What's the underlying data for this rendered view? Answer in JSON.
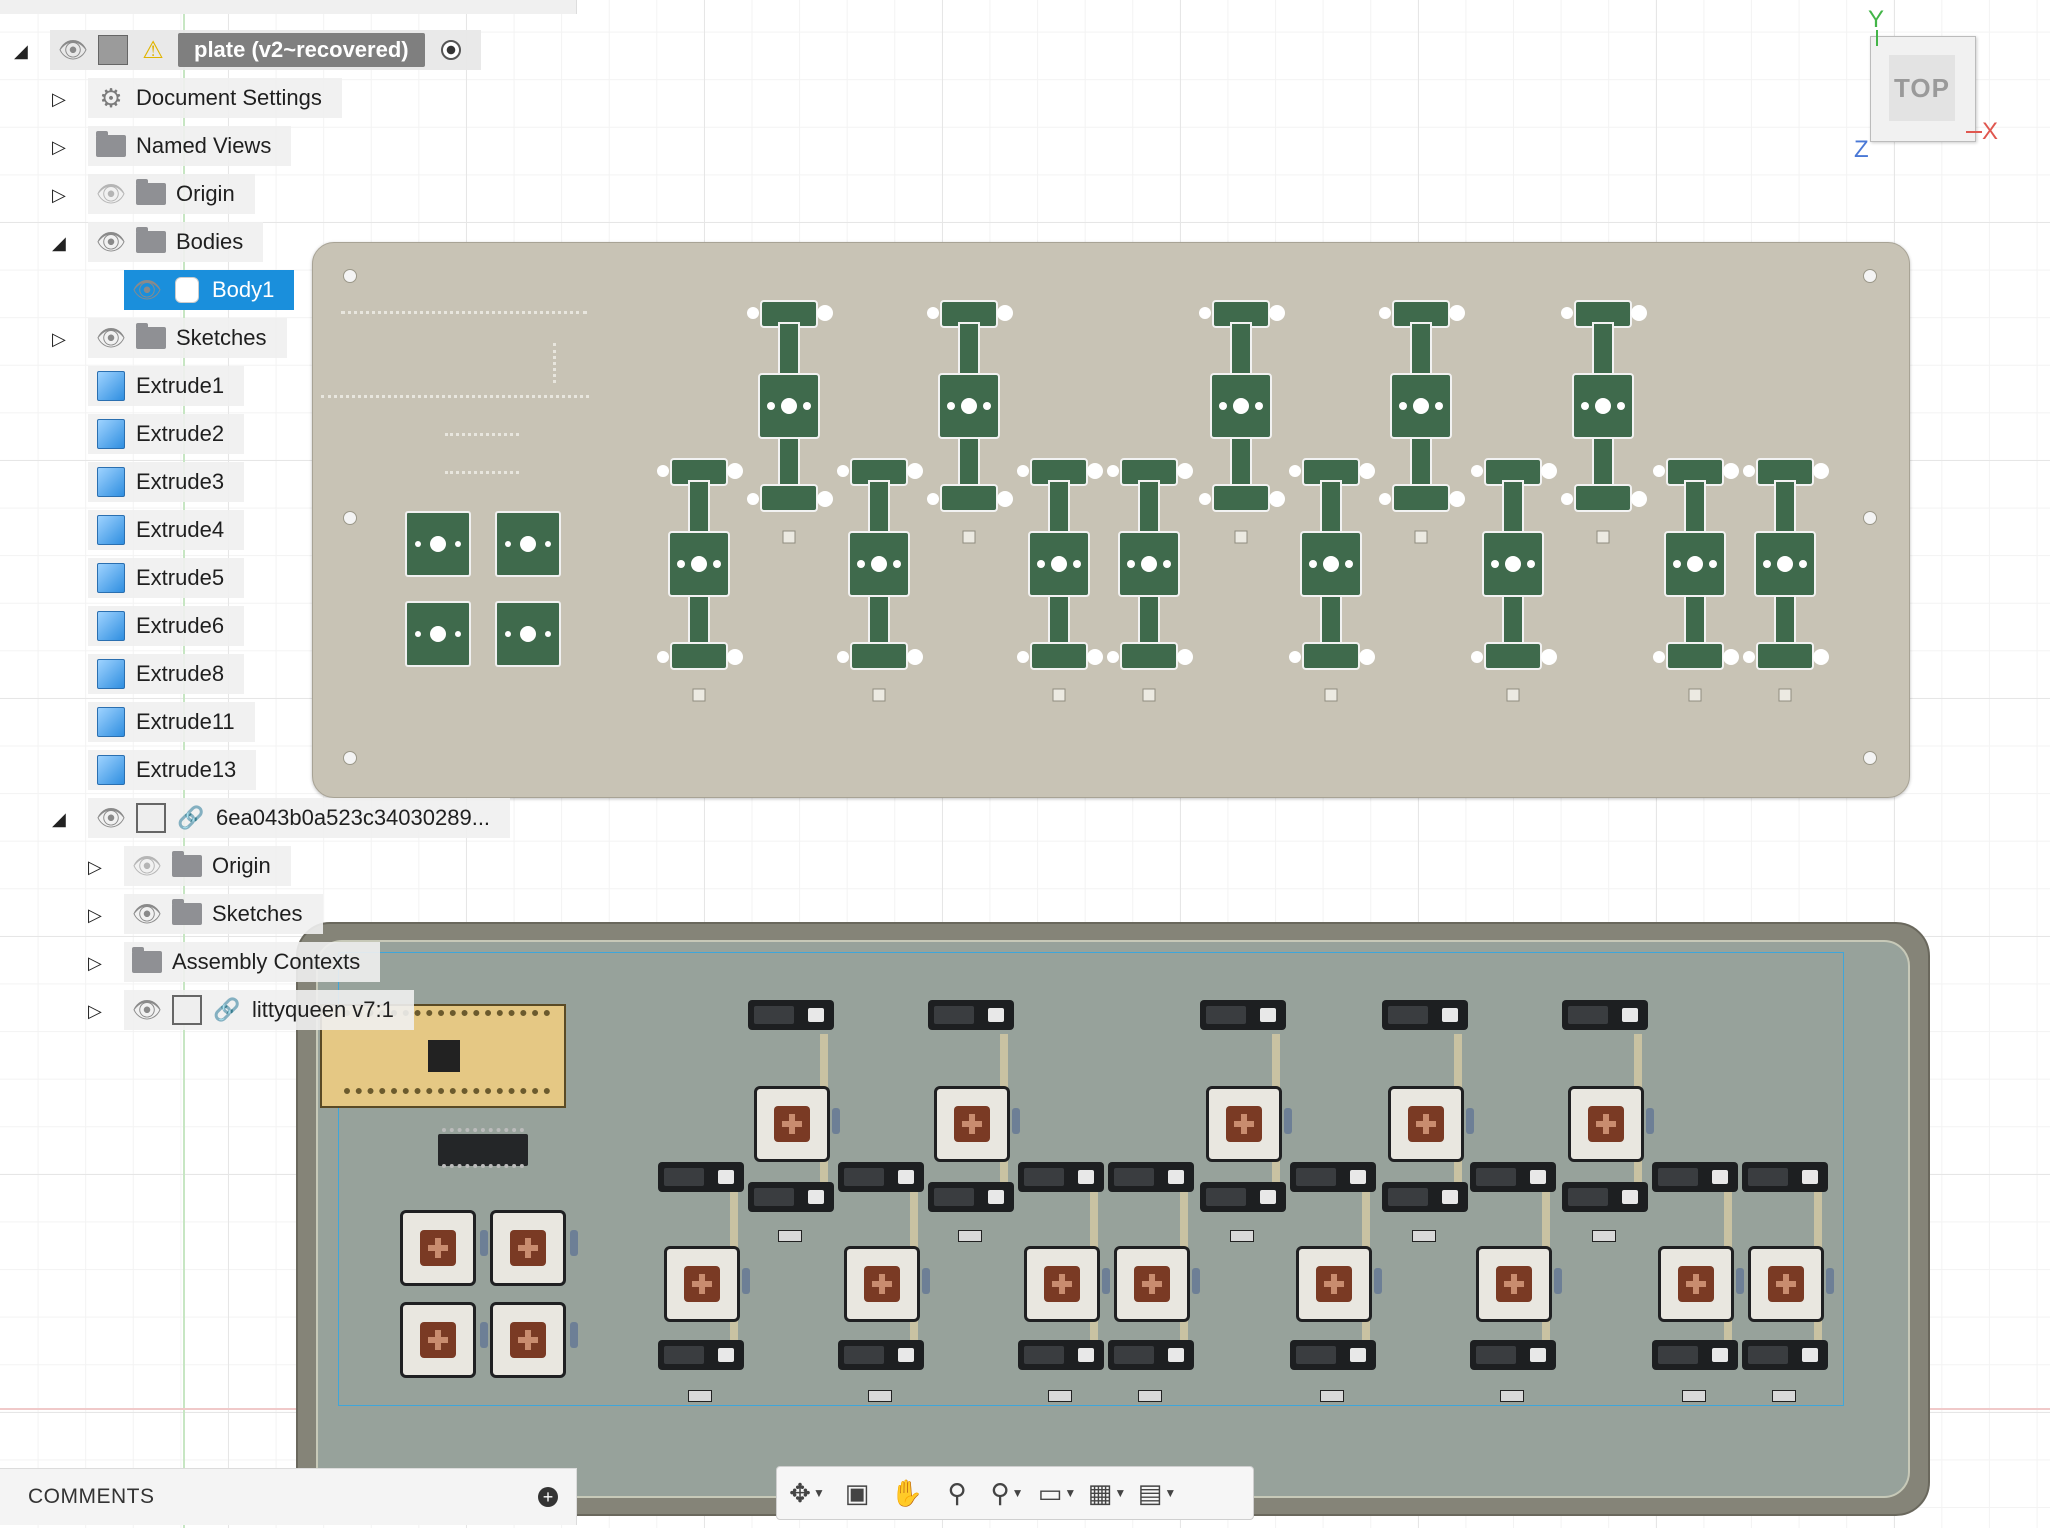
{
  "browser": {
    "root_label": "plate (v2~recovered)",
    "items": [
      {
        "label": "Document Settings"
      },
      {
        "label": "Named Views"
      },
      {
        "label": "Origin"
      },
      {
        "label": "Bodies"
      },
      {
        "label": "Body1"
      },
      {
        "label": "Sketches"
      },
      {
        "label": "Extrude1"
      },
      {
        "label": "Extrude2"
      },
      {
        "label": "Extrude3"
      },
      {
        "label": "Extrude4"
      },
      {
        "label": "Extrude5"
      },
      {
        "label": "Extrude6"
      },
      {
        "label": "Extrude8"
      },
      {
        "label": "Extrude11"
      },
      {
        "label": "Extrude13"
      },
      {
        "label": "6ea043b0a523c34030289..."
      },
      {
        "label": "Origin"
      },
      {
        "label": "Sketches"
      },
      {
        "label": "Assembly Contexts"
      },
      {
        "label": "littyqueen v7:1"
      }
    ]
  },
  "comments": {
    "label": "COMMENTS"
  },
  "viewcube": {
    "face": "TOP",
    "axis_x": "X",
    "axis_y": "Y",
    "axis_z": "Z"
  },
  "colors": {
    "selection": "#1a8fdc",
    "plate": "#c8c3b5",
    "stabilizer_pad": "#3f6a4c",
    "pcb": "#97a29b",
    "pcb_outline": "#3fa6da"
  },
  "toolbar": {
    "icons": [
      "orbit-icon",
      "look-at-icon",
      "pan-icon",
      "zoom-icon",
      "fit-icon",
      "display-settings-icon",
      "grid-settings-icon",
      "viewports-icon"
    ]
  }
}
